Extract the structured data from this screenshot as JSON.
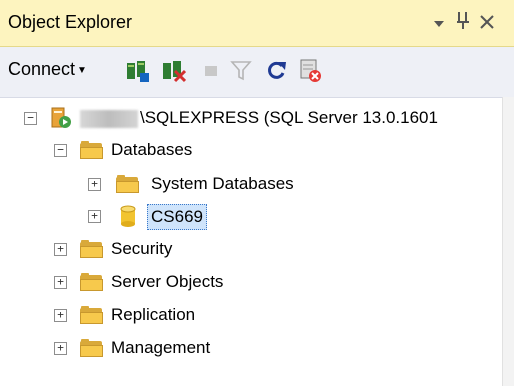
{
  "titlebar": {
    "title": "Object Explorer",
    "icons": [
      "dropdown-arrow-icon",
      "pin-icon",
      "close-icon"
    ]
  },
  "toolbar": {
    "connect_label": "Connect",
    "tools": [
      "connect-object-explorer-icon",
      "disconnect-icon",
      "stop-icon",
      "filter-icon",
      "refresh-icon",
      "activity-monitor-icon"
    ]
  },
  "tree": {
    "server": {
      "label": "\\SQLEXPRESS (SQL Server 13.0.1601",
      "expanded": true
    },
    "databases": {
      "label": "Databases",
      "expanded": true
    },
    "system_databases": {
      "label": "System Databases"
    },
    "cs669": {
      "label": "CS669",
      "selected": true
    },
    "security": {
      "label": "Security"
    },
    "server_objects": {
      "label": "Server Objects"
    },
    "replication": {
      "label": "Replication"
    },
    "management": {
      "label": "Management"
    }
  },
  "glyphs": {
    "expand": "+",
    "collapse": "−"
  },
  "colors": {
    "titlebar_bg": "#fdf4bf",
    "toolbar_bg": "#eef0f6",
    "folder": "#f7c94c",
    "selection": "#cfe4fb"
  }
}
